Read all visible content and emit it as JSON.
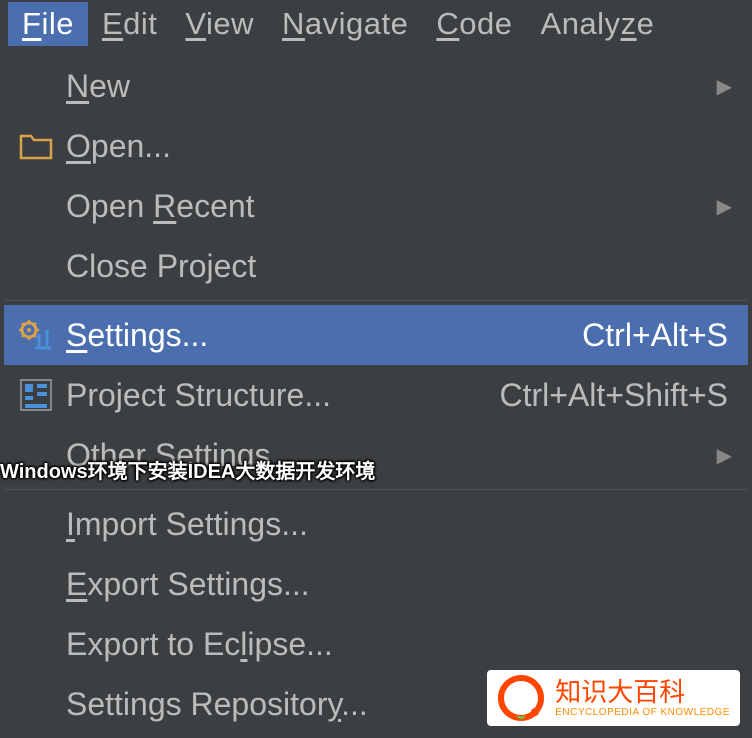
{
  "menubar": {
    "items": [
      {
        "pre": "",
        "u": "F",
        "post": "ile",
        "active": true
      },
      {
        "pre": "",
        "u": "E",
        "post": "dit",
        "active": false
      },
      {
        "pre": "",
        "u": "V",
        "post": "iew",
        "active": false
      },
      {
        "pre": "",
        "u": "N",
        "post": "avigate",
        "active": false
      },
      {
        "pre": "",
        "u": "C",
        "post": "ode",
        "active": false
      },
      {
        "pre": "Analy",
        "u": "z",
        "post": "e",
        "active": false
      }
    ]
  },
  "menu": [
    {
      "type": "item",
      "pre": "",
      "u": "N",
      "post": "ew",
      "shortcut": "",
      "icon": "",
      "arrow": true,
      "hl": false
    },
    {
      "type": "item",
      "pre": "",
      "u": "O",
      "post": "pen...",
      "shortcut": "",
      "icon": "folder",
      "arrow": false,
      "hl": false
    },
    {
      "type": "item",
      "pre": "Open ",
      "u": "R",
      "post": "ecent",
      "shortcut": "",
      "icon": "",
      "arrow": true,
      "hl": false
    },
    {
      "type": "item",
      "pre": "Close Pro",
      "u": "j",
      "post": "ect",
      "shortcut": "",
      "icon": "",
      "arrow": false,
      "hl": false
    },
    {
      "type": "sep"
    },
    {
      "type": "item",
      "pre": "",
      "u": "S",
      "post": "ettings...",
      "shortcut": "Ctrl+Alt+S",
      "icon": "settings",
      "arrow": false,
      "hl": true
    },
    {
      "type": "item",
      "pre": "Project Structure...",
      "u": "",
      "post": "",
      "shortcut": "Ctrl+Alt+Shift+S",
      "icon": "structure",
      "arrow": false,
      "hl": false
    },
    {
      "type": "item",
      "pre": "Other Settings",
      "u": "",
      "post": "",
      "shortcut": "",
      "icon": "",
      "arrow": true,
      "hl": false
    },
    {
      "type": "sep"
    },
    {
      "type": "item",
      "pre": "",
      "u": "I",
      "post": "mport Settings...",
      "shortcut": "",
      "icon": "",
      "arrow": false,
      "hl": false
    },
    {
      "type": "item",
      "pre": "",
      "u": "E",
      "post": "xport Settings...",
      "shortcut": "",
      "icon": "",
      "arrow": false,
      "hl": false
    },
    {
      "type": "item",
      "pre": "Export to Ec",
      "u": "l",
      "post": "ipse...",
      "shortcut": "",
      "icon": "",
      "arrow": false,
      "hl": false
    },
    {
      "type": "item",
      "pre": "Settings Repositor",
      "u": "y",
      "post": "...",
      "shortcut": "",
      "icon": "",
      "arrow": false,
      "hl": false
    }
  ],
  "overlay": "Windows环境下安装IDEA大数据开发环境",
  "watermark": {
    "cn": "知识大百科",
    "en": "ENCYCLOPEDIA OF KNOWLEDGE"
  }
}
